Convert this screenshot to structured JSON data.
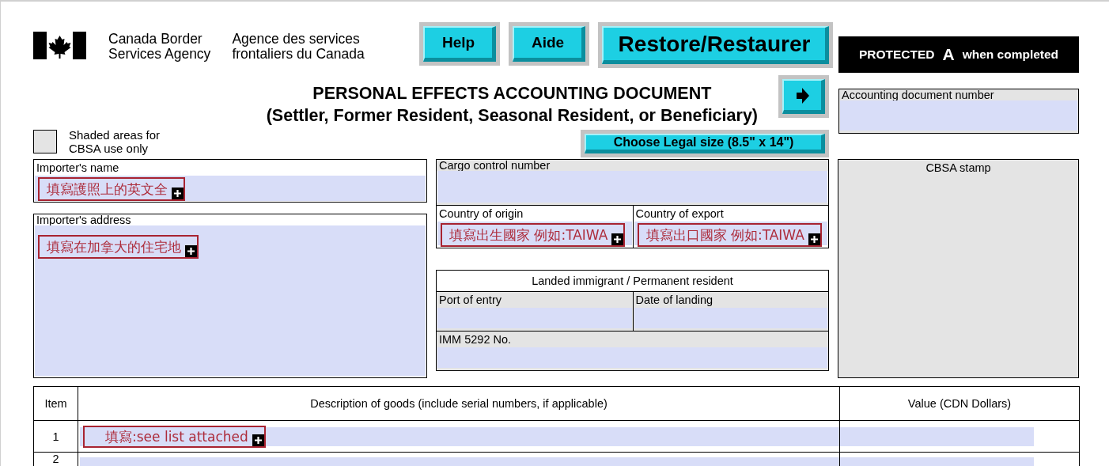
{
  "agency": {
    "name_en": [
      "Canada Border",
      "Services Agency"
    ],
    "name_fr": [
      "Agence des services",
      "frontaliers du Canada"
    ]
  },
  "buttons": [
    {
      "label": "Help",
      "kind": "medium"
    },
    {
      "label": "Aide",
      "kind": "medium"
    },
    {
      "label": "Restore/Restaurer",
      "kind": "large"
    }
  ],
  "protected": {
    "prefix": "PROTECTED",
    "grade": "A",
    "suffix": "when completed"
  },
  "title": [
    "PERSONAL EFFECTS ACCOUNTING DOCUMENT",
    "(Settler, Former Resident, Seasonal Resident, or Beneficiary)"
  ],
  "shaded_note": "Shaded areas for CBSA use only",
  "size_button": "Choose Legal size (8.5\" x 14\")",
  "fields": [
    {
      "label": "Accounting document number",
      "shaded": true
    },
    {
      "label": "Importer's name",
      "shaded": false,
      "annotation": "填寫護照上的英文全"
    },
    {
      "label": "Importer's address",
      "shaded": false,
      "annotation": "填寫在加拿大的住宅地"
    },
    {
      "label": "Cargo control number",
      "shaded": true
    },
    {
      "label": "Country of origin",
      "shaded": false,
      "annotation": "填寫出生國家 例如:TAIWA"
    },
    {
      "label": "Country of export",
      "shaded": false,
      "annotation": "填寫出口國家 例如:TAIWA"
    },
    {
      "label": "CBSA stamp",
      "shaded": true
    }
  ],
  "landed": {
    "title": "Landed immigrant / Permanent resident",
    "fields": [
      {
        "label": "Port of entry",
        "shaded": true
      },
      {
        "label": "Date of landing",
        "shaded": true
      },
      {
        "label": "IMM 5292 No.",
        "shaded": true
      }
    ]
  },
  "goods_table": {
    "columns": [
      "Item",
      "Description of goods (include serial numbers, if applicable)",
      "Value (CDN Dollars)"
    ],
    "rows": [
      {
        "item": "1",
        "annotation": "填寫:see list attached"
      },
      {
        "item": "2"
      }
    ]
  }
}
